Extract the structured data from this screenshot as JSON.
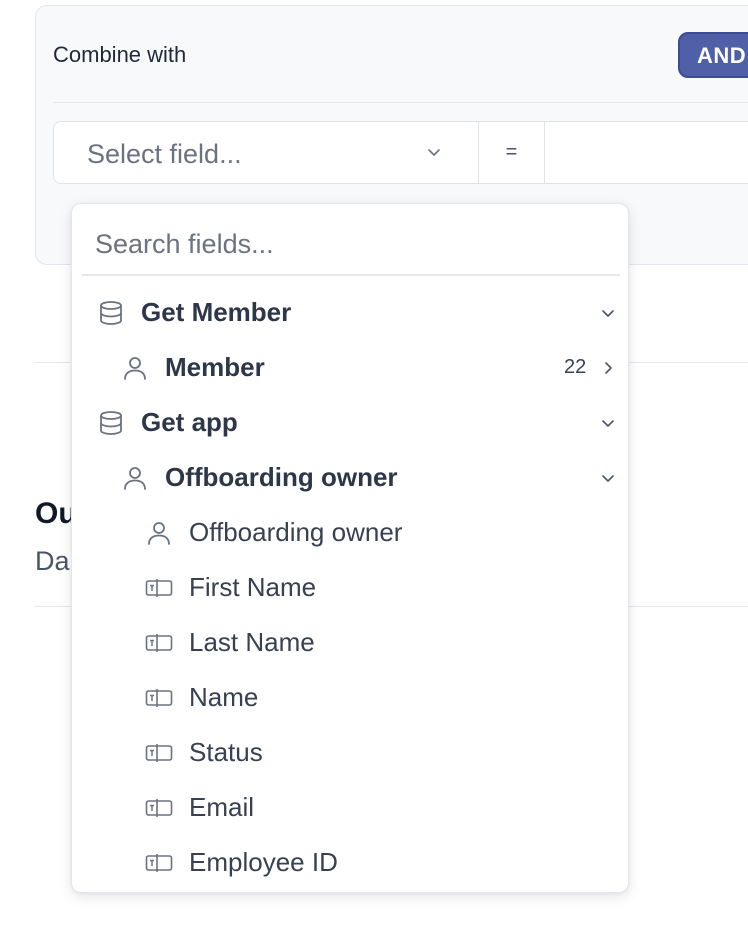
{
  "condition_card": {
    "label": "Combine with",
    "combinator": "AND",
    "row": {
      "field_placeholder": "Select field...",
      "operator": "=",
      "value": ""
    }
  },
  "background": {
    "title": "Ou",
    "subtitle": "Da"
  },
  "dropdown": {
    "search_placeholder": "Search fields...",
    "items": [
      {
        "label": "Get Member",
        "icon": "database-icon",
        "level": 0,
        "expanded": true
      },
      {
        "label": "Member",
        "icon": "user-icon",
        "level": 1,
        "count": "22",
        "expanded": false
      },
      {
        "label": "Get app",
        "icon": "database-icon",
        "level": 0,
        "expanded": true
      },
      {
        "label": "Offboarding owner",
        "icon": "user-icon",
        "level": 1,
        "expanded": true
      },
      {
        "label": "Offboarding owner",
        "icon": "user-icon",
        "level": 2
      },
      {
        "label": "First Name",
        "icon": "text-field-icon",
        "level": 2
      },
      {
        "label": "Last Name",
        "icon": "text-field-icon",
        "level": 2
      },
      {
        "label": "Name",
        "icon": "text-field-icon",
        "level": 2
      },
      {
        "label": "Status",
        "icon": "text-field-icon",
        "level": 2
      },
      {
        "label": "Email",
        "icon": "text-field-icon",
        "level": 2
      },
      {
        "label": "Employee ID",
        "icon": "text-field-icon",
        "level": 2
      }
    ]
  },
  "colors": {
    "accent": "#4f5fa8",
    "text": "#374151",
    "muted": "#6b7280",
    "border": "#e3e6ec"
  }
}
